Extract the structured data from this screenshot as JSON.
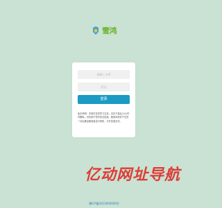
{
  "brand": {
    "logo_text": "雪鸿",
    "icon": "cloud-logo-icon"
  },
  "login_form": {
    "key_placeholder": "请输入卡密",
    "captcha_placeholder": "验证",
    "submit_label": "登录",
    "notice": "免责声明：本软件仅供学习交流，请在下载后24小时内删除，切勿用于任何非法用途。使用本软件产生的一切后果由使用者自行承担，与开发者无关。"
  },
  "watermark": {
    "text": "亿动网址导航"
  },
  "footer": {
    "icp": "豫ICP备2023000000号"
  },
  "colors": {
    "background": "#c9e2d3",
    "primary_button": "#1b9bc3",
    "watermark": "#e02e2a",
    "logo_text": "#6cb42a"
  }
}
